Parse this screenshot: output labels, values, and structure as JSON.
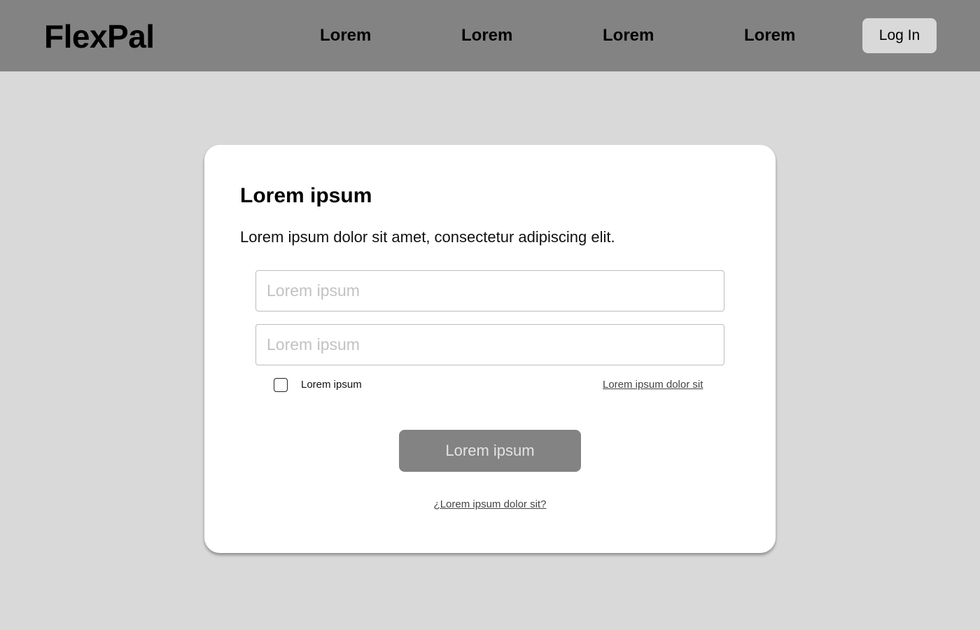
{
  "header": {
    "logo": "FlexPal",
    "nav": [
      "Lorem",
      "Lorem",
      "Lorem",
      "Lorem"
    ],
    "login_label": "Log In"
  },
  "card": {
    "title": "Lorem ipsum",
    "description": "Lorem ipsum dolor sit amet, consectetur adipiscing elit.",
    "field_1": {
      "placeholder": "Lorem ipsum",
      "value": ""
    },
    "field_2": {
      "placeholder": "Lorem ipsum",
      "value": ""
    },
    "checkbox_label": "Lorem ipsum",
    "checkbox_checked": false,
    "forgot_link": "Lorem ipsum dolor sit",
    "submit_label": "Lorem ipsum",
    "bottom_link": "¿Lorem ipsum dolor sit?"
  },
  "colors": {
    "page_background": "#d9d9d9",
    "header_background": "#838383",
    "card_background": "#ffffff",
    "primary_button": "#838383"
  }
}
